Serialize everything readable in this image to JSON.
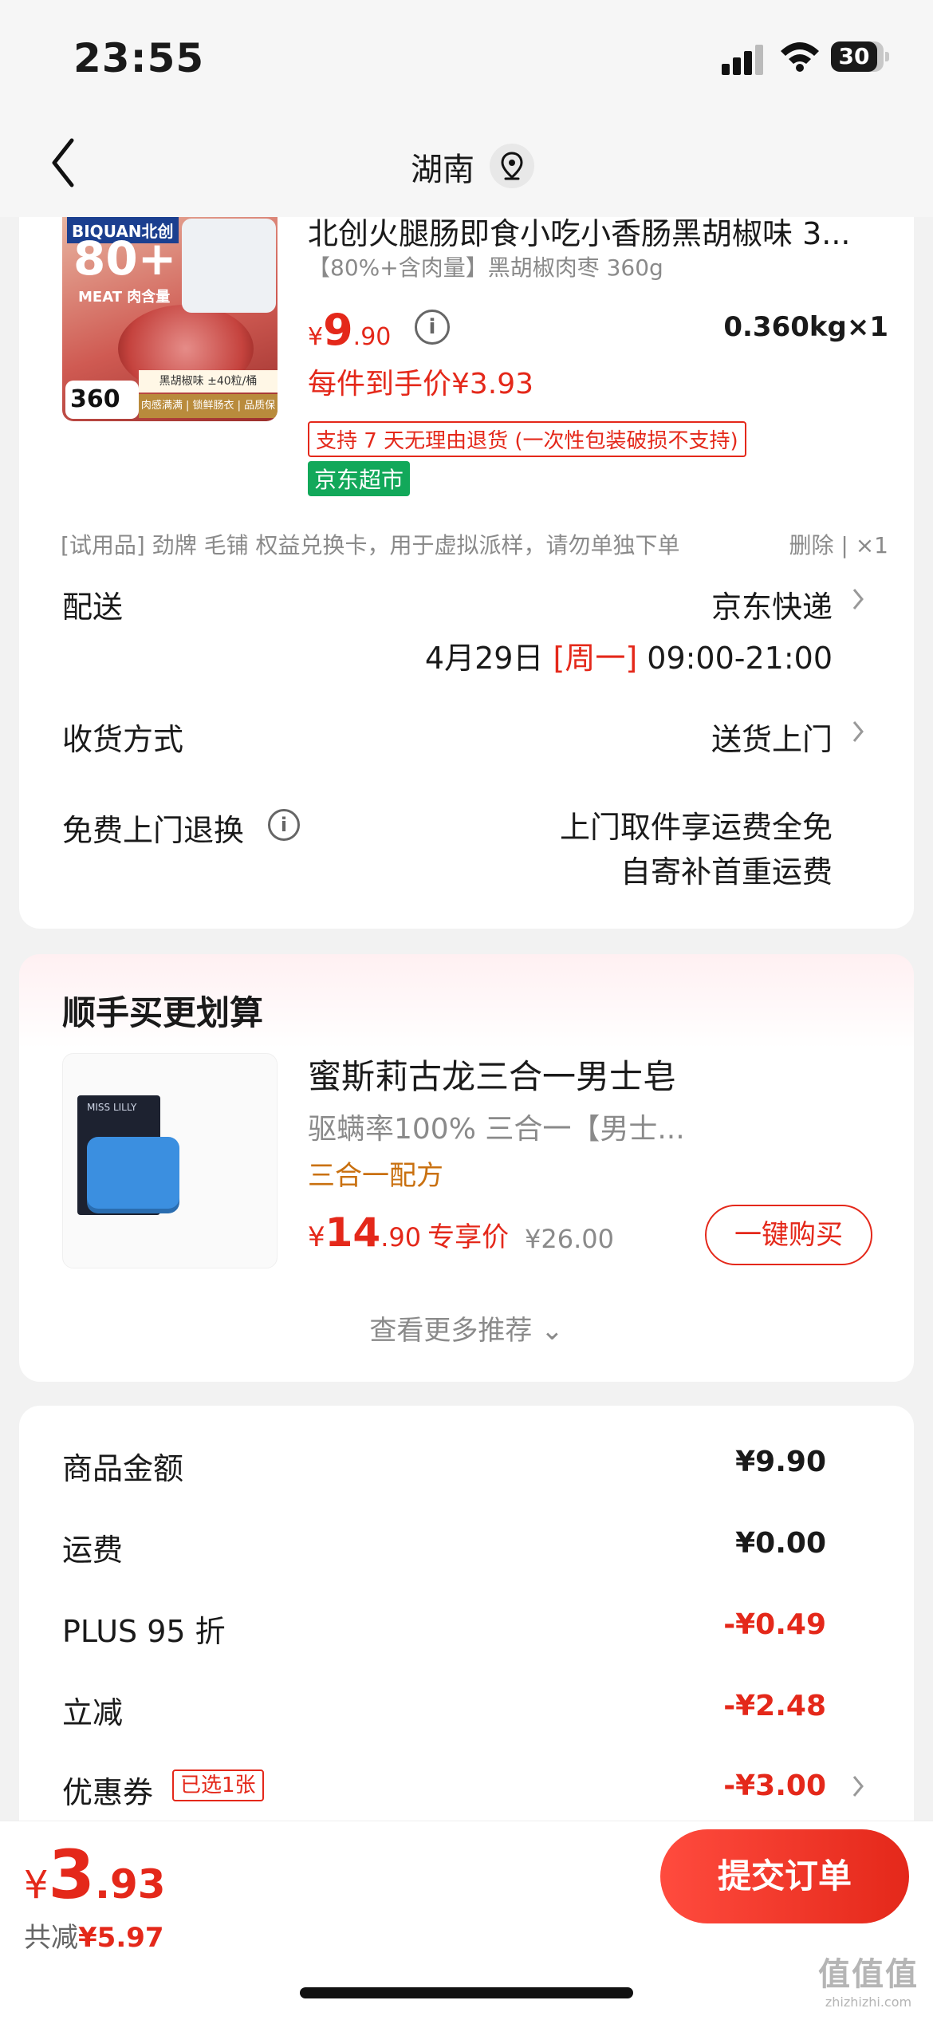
{
  "status_bar": {
    "time": "23:55",
    "battery": "30"
  },
  "header": {
    "title": "湖南",
    "location_icon": "location-pin-icon"
  },
  "product": {
    "image_text": {
      "brand": "BIQUAN北创",
      "percent": "80+",
      "meat_label": "MEAT 肉含量",
      "weight": "360",
      "flavor": "黑胡椒味 ±40粒/桶",
      "strip": "肉感满满 | 锁鲜肠衣 | 品质保证"
    },
    "name": "北创火腿肠即食小吃小香肠黑胡椒味 3...",
    "spec": "【80%+含肉量】黑胡椒肉枣 360g",
    "price_symbol": "¥",
    "price_int": "9",
    "price_dec": ".90",
    "qty": "0.360kg×1",
    "net_price": "每件到手价¥3.93",
    "return_tag": "支持 7 天无理由退货 (一次性包装破损不支持)",
    "store_tag": "京东超市"
  },
  "trial": {
    "text": "[试用品] 劲牌 毛铺 权益兑换卡，用于虚拟派样，请勿单独下单",
    "action": "删除 | ×1"
  },
  "delivery": {
    "label": "配送",
    "carrier": "京东快递",
    "date": "4月29日",
    "weekday": "[周一]",
    "time": "09:00-21:00"
  },
  "receive": {
    "label": "收货方式",
    "value": "送货上门"
  },
  "free_return": {
    "label": "免费上门退换",
    "line1": "上门取件享运费全免",
    "line2": "自寄补首重运费"
  },
  "recommend": {
    "title": "顺手买更划算",
    "item": {
      "name": "蜜斯莉古龙三合一男士皂",
      "desc": "驱螨率100% 三合一【男士...",
      "feature": "三合一配方",
      "price_symbol": "¥",
      "price_int": "14",
      "price_dec": ".90",
      "price_tag": "专享价",
      "orig_price": "¥26.00",
      "buy_label": "一键购买",
      "logo": "MISS LILLY"
    },
    "more_label": "查看更多推荐 ⌄"
  },
  "summary": [
    {
      "label": "商品金额",
      "value": "¥9.90",
      "red": false
    },
    {
      "label": "运费",
      "value": "¥0.00",
      "red": false
    },
    {
      "label": "PLUS 95 折",
      "value": "-¥0.49",
      "red": true
    },
    {
      "label": "立减",
      "value": "-¥2.48",
      "red": true
    },
    {
      "label": "优惠券",
      "value": "-¥3.00",
      "red": true,
      "tag": "已选1张"
    }
  ],
  "bottom": {
    "total_symbol": "¥",
    "total_int": "3",
    "total_dec": ".93",
    "saved_prefix": "共减",
    "saved_value": "¥5.97",
    "submit_label": "提交订单"
  },
  "watermark": {
    "line1": "值值值",
    "line2": "zhizhizhi.com"
  },
  "colors": {
    "accent": "#e4281a",
    "jd_green": "#12a85a",
    "feature_orange": "#c9700f"
  }
}
